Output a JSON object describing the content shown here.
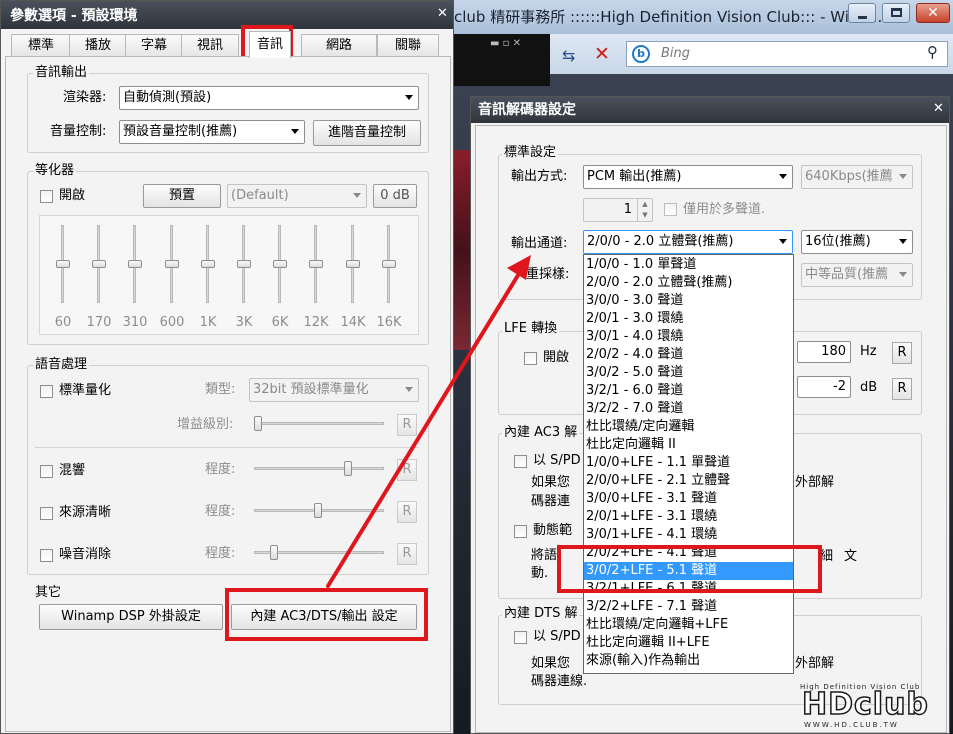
{
  "browser": {
    "title": "club 精研事務所 ::::::High Definition Vision Club::: - Wind...",
    "search_placeholder": "Bing"
  },
  "prefs": {
    "title": "參數選項 - 預設環境",
    "tabs": [
      "標準",
      "播放",
      "字幕",
      "視訊",
      "音訊",
      "網路",
      "關聯"
    ],
    "active_tab": "音訊",
    "audio_output": {
      "label": "音訊輸出",
      "renderer_label": "渲染器:",
      "renderer_value": "自動偵測(預設)",
      "volume_label": "音量控制:",
      "volume_value": "預設音量控制(推薦)",
      "advanced_button": "進階音量控制"
    },
    "equalizer": {
      "label": "等化器",
      "enable": "開啟",
      "preset_button": "預置",
      "preset_value": "(Default)",
      "gain": "0 dB",
      "bands": [
        "60",
        "170",
        "310",
        "600",
        "1K",
        "3K",
        "6K",
        "12K",
        "14K",
        "16K"
      ]
    },
    "voice": {
      "label": "語音處理",
      "normalize": "標準量化",
      "type_label": "類型:",
      "type_value": "32bit 預設標準量化",
      "gain_level": "增益級別:",
      "reverb": "混響",
      "clarity": "來源清晰",
      "denoise": "噪音消除",
      "degree": "程度:",
      "reset": "R"
    },
    "other": {
      "label": "其它",
      "winamp_button": "Winamp DSP 外掛設定",
      "builtin_button": "內建 AC3/DTS/輸出 設定"
    }
  },
  "decoder": {
    "title": "音訊解碼器設定",
    "standard": {
      "label": "標準設定",
      "output_mode_label": "輸出方式:",
      "output_mode_value": "PCM 輸出(推薦)",
      "bitrate": "640Kbps(推薦",
      "count": "1",
      "multichannel_only": "僅用於多聲道.",
      "channels_label": "輸出通道:",
      "channels_value": "2/0/0 - 2.0 立體聲(推薦)",
      "bits_value": "16位(推薦)",
      "resample_label": "重採樣:",
      "quality_value": "中等品質(推薦"
    },
    "lfe": {
      "label": "LFE 轉換",
      "enable": "開啟",
      "freq": "180",
      "freq_unit": "Hz",
      "gain": "-2",
      "gain_unit": "dB",
      "reset": "R"
    },
    "ac3": {
      "label": "內建 AC3 解",
      "spdif": "以 S/PD",
      "desc1": "如果您",
      "desc1_tail": "外部解",
      "desc2": "碼器連",
      "drc": "動態範",
      "drc_desc1": "將語",
      "drc_desc1_tail": "細",
      "drc_desc1_tail2": "文",
      "drc_desc2": "動."
    },
    "dts": {
      "label": "內建 DTS 解",
      "spdif": "以 S/PD",
      "desc1": "如果您",
      "desc1_tail": "外部解",
      "desc2": "碼器連線."
    },
    "channel_options": [
      "1/0/0 - 1.0 單聲道",
      "2/0/0 - 2.0 立體聲(推薦)",
      "3/0/0 - 3.0 聲道",
      "2/0/1 - 3.0 環繞",
      "3/0/1 - 4.0 環繞",
      "2/0/2 - 4.0 聲道",
      "3/0/2 - 5.0 聲道",
      "3/2/1 - 6.0 聲道",
      "3/2/2 - 7.0 聲道",
      "杜比環繞/定向邏輯",
      "杜比定向邏輯 II",
      "1/0/0+LFE - 1.1 單聲道",
      "2/0/0+LFE - 2.1 立體聲",
      "3/0/0+LFE - 3.1 聲道",
      "2/0/1+LFE - 3.1 環繞",
      "3/0/1+LFE - 4.1 環繞",
      "2/0/2+LFE - 4.1 聲道",
      "3/0/2+LFE - 5.1 聲道",
      "3/2/1+LFE - 6.1 聲道",
      "3/2/2+LFE - 7.1 聲道",
      "杜比環繞/定向邏輯+LFE",
      "杜比定向邏輯 II+LFE",
      "來源(輸入)作為輸出"
    ],
    "selected_index": 17
  },
  "watermark": {
    "tagline": "High Definition Vision Club",
    "logo": "HDclub",
    "url": "WWW.HD.CLUB.TW"
  },
  "colors": {
    "highlight": "#e0161d",
    "selection": "#3399ff",
    "titlebar": "#3a3f48"
  }
}
